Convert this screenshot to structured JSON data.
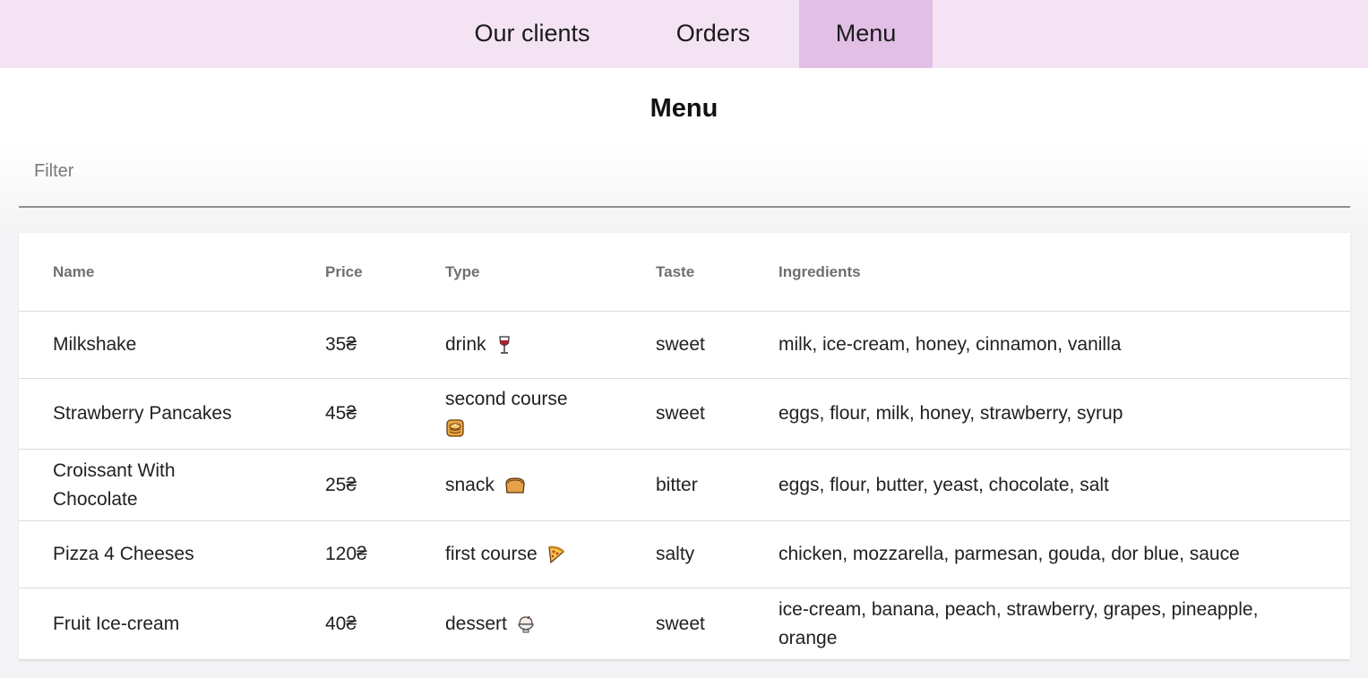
{
  "nav": {
    "tabs": [
      {
        "label": "Our clients"
      },
      {
        "label": "Orders"
      },
      {
        "label": "Menu"
      }
    ],
    "active": "Menu"
  },
  "page_title": "Menu",
  "filter": {
    "placeholder": "Filter",
    "value": ""
  },
  "table": {
    "columns": [
      "Name",
      "Price",
      "Type",
      "Taste",
      "Ingredients"
    ],
    "rows": [
      {
        "name": "Milkshake",
        "price": "35₴",
        "type": "drink",
        "type_icon": "wine-glass-icon",
        "taste": "sweet",
        "ingredients": "milk, ice-cream, honey, cinnamon, vanilla"
      },
      {
        "name": "Strawberry Pancakes",
        "price": "45₴",
        "type": "second course",
        "type_icon": "pancakes-icon",
        "taste": "sweet",
        "ingredients": "eggs, flour, milk, honey, strawberry, syrup"
      },
      {
        "name": "Croissant With Chocolate",
        "price": "25₴",
        "type": "snack",
        "type_icon": "bread-icon",
        "taste": "bitter",
        "ingredients": "eggs, flour, butter, yeast, chocolate, salt"
      },
      {
        "name": "Pizza 4 Cheeses",
        "price": "120₴",
        "type": "first course",
        "type_icon": "pizza-icon",
        "taste": "salty",
        "ingredients": "chicken, mozzarella, parmesan, gouda, dor blue, sauce"
      },
      {
        "name": "Fruit Ice-cream",
        "price": "40₴",
        "type": "dessert",
        "type_icon": "shaved-ice-icon",
        "taste": "sweet",
        "ingredients": "ice-cream, banana, peach, strawberry, grapes, pineapple, orange"
      }
    ]
  },
  "colors": {
    "nav_background": "#f3e3f3",
    "nav_active": "#e2c0e6",
    "header_text": "#6f6f6f",
    "divider": "#dcdcdc"
  }
}
